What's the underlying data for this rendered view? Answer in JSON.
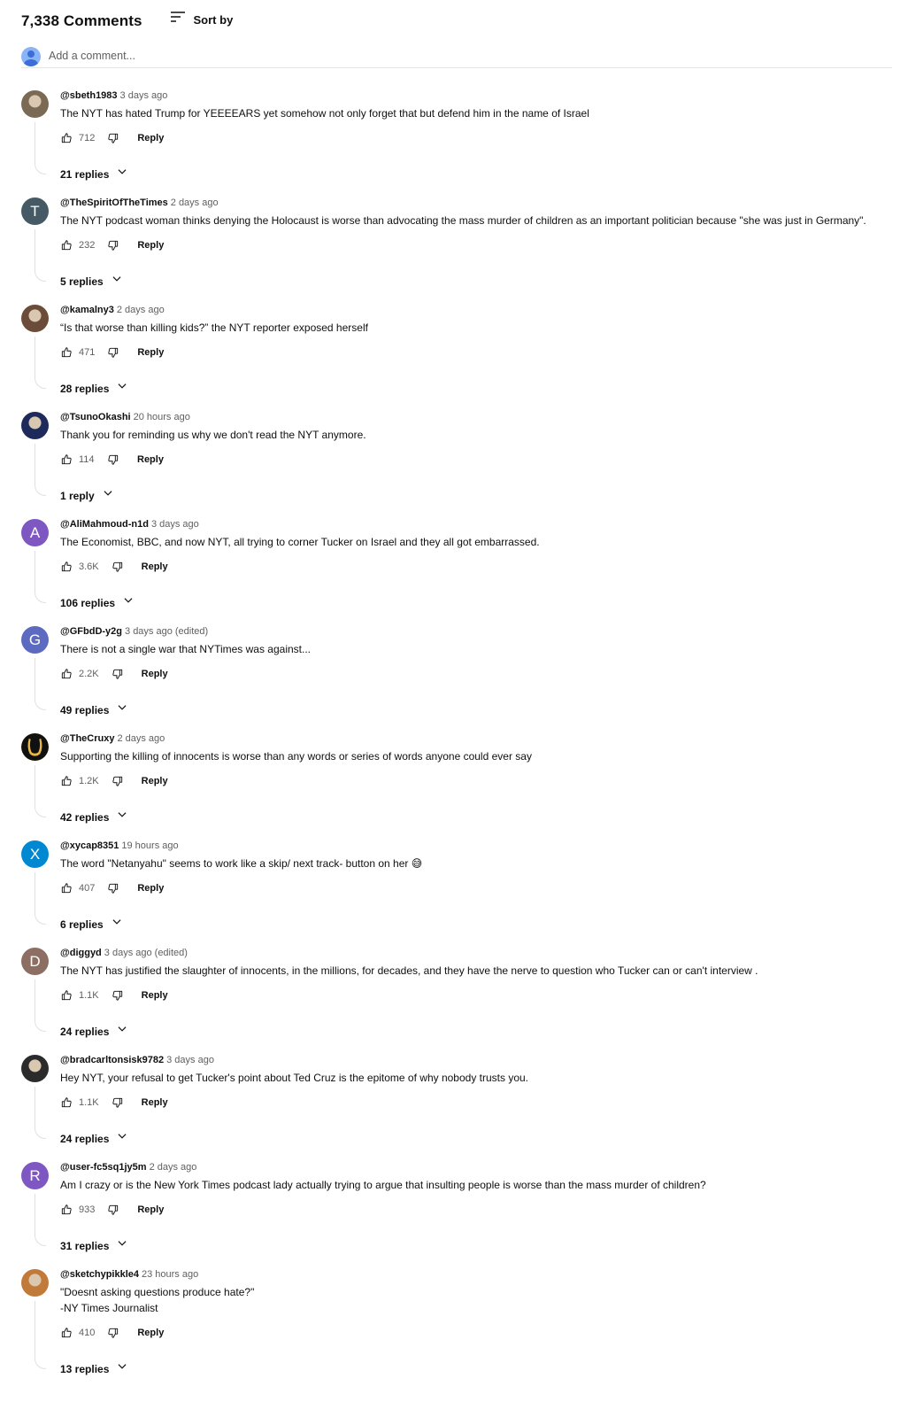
{
  "header": {
    "count_label": "7,338 Comments",
    "sort_label": "Sort by"
  },
  "add_comment": {
    "placeholder": "Add a comment..."
  },
  "comments": [
    {
      "author": "@sbeth1983",
      "time": "3 days ago",
      "text": "The NYT has hated Trump for YEEEEARS yet somehow not only forget that but defend him in the name of Israel",
      "likes": "712",
      "reply_label": "Reply",
      "replies": "21 replies",
      "avatar": {
        "kind": "photo",
        "initial": "",
        "color": "#7a6a55"
      }
    },
    {
      "author": "@TheSpiritOfTheTimes",
      "time": "2 days ago",
      "text": "The NYT podcast woman thinks denying the Holocaust is worse than advocating the mass murder of children as an important politician because \"she was just in Germany\".",
      "likes": "232",
      "reply_label": "Reply",
      "replies": "5 replies",
      "avatar": {
        "kind": "letter",
        "initial": "T",
        "color": "#455a64"
      }
    },
    {
      "author": "@kamalny3",
      "time": "2 days ago",
      "text": "“Is that worse than killing kids?” the NYT reporter exposed herself",
      "likes": "471",
      "reply_label": "Reply",
      "replies": "28 replies",
      "avatar": {
        "kind": "photo",
        "initial": "",
        "color": "#6b4b3a"
      }
    },
    {
      "author": "@TsunoOkashi",
      "time": "20 hours ago",
      "text": "Thank you for reminding us why we don't read the NYT anymore.",
      "likes": "114",
      "reply_label": "Reply",
      "replies": "1 reply",
      "avatar": {
        "kind": "photo",
        "initial": "",
        "color": "#1e2a5a"
      }
    },
    {
      "author": "@AliMahmoud-n1d",
      "time": "3 days ago",
      "text": "The Economist, BBC, and now NYT, all trying to corner Tucker on Israel and they all got embarrassed.",
      "likes": "3.6K",
      "reply_label": "Reply",
      "replies": "106 replies",
      "avatar": {
        "kind": "letter",
        "initial": "A",
        "color": "#7e57c2"
      }
    },
    {
      "author": "@GFbdD-y2g",
      "time": "3 days ago (edited)",
      "text": "There is not a single war that NYTimes was against...",
      "likes": "2.2K",
      "reply_label": "Reply",
      "replies": "49 replies",
      "avatar": {
        "kind": "letter",
        "initial": "G",
        "color": "#5c6bc0"
      }
    },
    {
      "author": "@TheCruxy",
      "time": "2 days ago",
      "text": "Supporting the killing of innocents is worse than any words or series of words anyone could ever say",
      "likes": "1.2K",
      "reply_label": "Reply",
      "replies": "42 replies",
      "avatar": {
        "kind": "ring",
        "initial": "",
        "color": "#111111"
      }
    },
    {
      "author": "@xycap8351",
      "time": "19 hours ago",
      "text": "The word \"Netanyahu\" seems to work like a skip/ next track- button on her 😅",
      "likes": "407",
      "reply_label": "Reply",
      "replies": "6 replies",
      "avatar": {
        "kind": "letter",
        "initial": "X",
        "color": "#0288d1"
      }
    },
    {
      "author": "@diggyd",
      "time": "3 days ago (edited)",
      "text": "The NYT has justified the slaughter of innocents, in the millions, for decades, and they have the nerve to question who Tucker can or can't interview .",
      "likes": "1.1K",
      "reply_label": "Reply",
      "replies": "24 replies",
      "avatar": {
        "kind": "letter",
        "initial": "D",
        "color": "#8d6e63"
      }
    },
    {
      "author": "@bradcarltonsisk9782",
      "time": "3 days ago",
      "text": "Hey NYT, your refusal to get Tucker's point about Ted Cruz is the epitome of why nobody trusts you.",
      "likes": "1.1K",
      "reply_label": "Reply",
      "replies": "24 replies",
      "avatar": {
        "kind": "photo",
        "initial": "",
        "color": "#2b2b2b"
      }
    },
    {
      "author": "@user-fc5sq1jy5m",
      "time": "2 days ago",
      "text": "Am I crazy or is the New York Times podcast lady actually trying to argue that insulting people is worse than the mass murder of children?",
      "likes": "933",
      "reply_label": "Reply",
      "replies": "31 replies",
      "avatar": {
        "kind": "letter",
        "initial": "R",
        "color": "#7e57c2"
      }
    },
    {
      "author": "@sketchypikkle4",
      "time": "23 hours ago",
      "text": "\"Doesnt asking questions produce hate?\"\n-NY Times Journalist",
      "likes": "410",
      "reply_label": "Reply",
      "replies": "13 replies",
      "avatar": {
        "kind": "photo",
        "initial": "",
        "color": "#c07a3a"
      }
    }
  ]
}
